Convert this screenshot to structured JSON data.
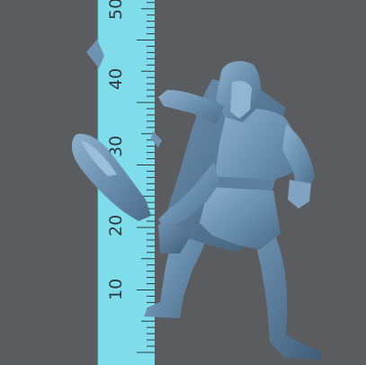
{
  "ruler": {
    "labels": [
      "10",
      "20",
      "30",
      "40",
      "50"
    ],
    "color": "#7fdcea",
    "ink": "#2f3a40"
  },
  "background_color": "#5a5c5f",
  "miniature_color": "#6b90b0",
  "subject": "3d-printed-miniature-hooded-figure"
}
